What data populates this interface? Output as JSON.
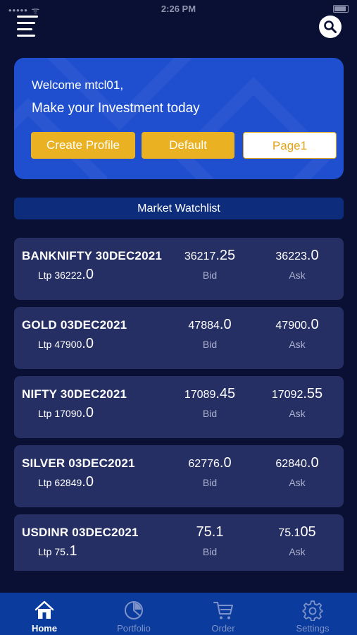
{
  "status_bar": {
    "signal": "••••• ᯤ",
    "time": "2:26 PM"
  },
  "header": {
    "menu_icon": "hamburger-menu-icon",
    "search_icon": "search-icon"
  },
  "welcome": {
    "greeting": "Welcome mtcl01,",
    "tagline": "Make your Investment today",
    "buttons": {
      "create_profile": "Create Profile",
      "default": "Default",
      "page1": "Page1"
    }
  },
  "watchlist": {
    "title": "Market Watchlist",
    "bid_label": "Bid",
    "ask_label": "Ask",
    "ltp_label": "Ltp",
    "items": [
      {
        "symbol": "BANKNIFTY 30DEC2021",
        "ltp_int": "36222",
        "ltp_dec": ".0",
        "bid_int": "36217",
        "bid_dec": ".25",
        "ask_int": "36223",
        "ask_dec": ".0"
      },
      {
        "symbol": "GOLD 03DEC2021",
        "ltp_int": "47900",
        "ltp_dec": ".0",
        "bid_int": "47884",
        "bid_dec": ".0",
        "ask_int": "47900",
        "ask_dec": ".0"
      },
      {
        "symbol": "NIFTY 30DEC2021",
        "ltp_int": "17090",
        "ltp_dec": ".0",
        "bid_int": "17089",
        "bid_dec": ".45",
        "ask_int": "17092",
        "ask_dec": ".55"
      },
      {
        "symbol": "SILVER 03DEC2021",
        "ltp_int": "62849",
        "ltp_dec": ".0",
        "bid_int": "62776",
        "bid_dec": ".0",
        "ask_int": "62840",
        "ask_dec": ".0"
      },
      {
        "symbol": "USDINR 03DEC2021",
        "ltp_int": "75",
        "ltp_dec": ".1",
        "bid_int": "75",
        "bid_dec": ".1",
        "ask_int": "75.1",
        "ask_dec": "05"
      }
    ]
  },
  "bottom_nav": {
    "items": [
      {
        "label": "Home",
        "icon": "home-icon",
        "active": true
      },
      {
        "label": "Portfolio",
        "icon": "pie-chart-icon",
        "active": false
      },
      {
        "label": "Order",
        "icon": "cart-icon",
        "active": false
      },
      {
        "label": "Settings",
        "icon": "gear-icon",
        "active": false
      }
    ]
  },
  "colors": {
    "background": "#0a1033",
    "card_blue": "#1f4fcf",
    "accent_gold": "#eab222",
    "row_bg": "#262f63",
    "nav_bg": "#0b3b9c"
  }
}
